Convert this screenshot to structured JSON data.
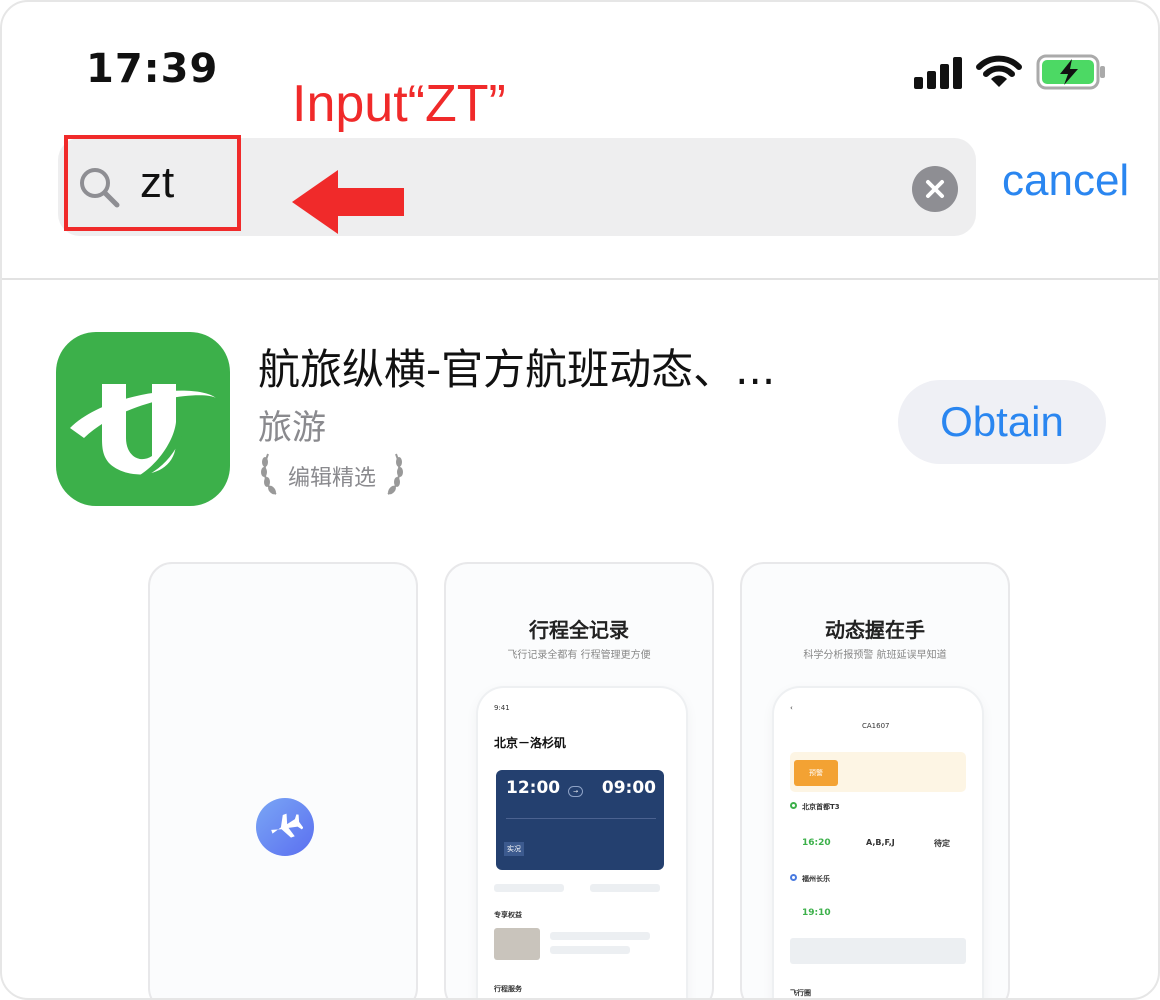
{
  "status_bar": {
    "time": "17:39"
  },
  "annotation": {
    "title": "Input“ZT”"
  },
  "search": {
    "query": "zt",
    "cancel_label": "cancel"
  },
  "app": {
    "name": "航旅纵横-官方航班动态、...",
    "category": "旅游",
    "editors_choice": "编辑精选",
    "obtain_label": "Obtain",
    "brand_color": "#3cb04a"
  },
  "screenshots": [
    {
      "title": "",
      "subtitle": ""
    },
    {
      "title": "行程全记录",
      "subtitle": "飞行记录全都有  行程管理更方便",
      "route": "北京－洛杉矶",
      "dep_time": "12:00",
      "arr_time": "09:00",
      "status": "实况",
      "section1": "专享权益",
      "section2": "行程服务"
    },
    {
      "title": "动态握在手",
      "subtitle": "科学分析报预警  航班延误早知道",
      "flight_no": "CA1607",
      "badge": "预警",
      "origin": "北京首都T3",
      "dep_time": "16:20",
      "seats": "A,B,F,J",
      "gate_status": "待定",
      "destination": "福州长乐",
      "arr_time": "19:10",
      "section": "飞行圈"
    }
  ]
}
